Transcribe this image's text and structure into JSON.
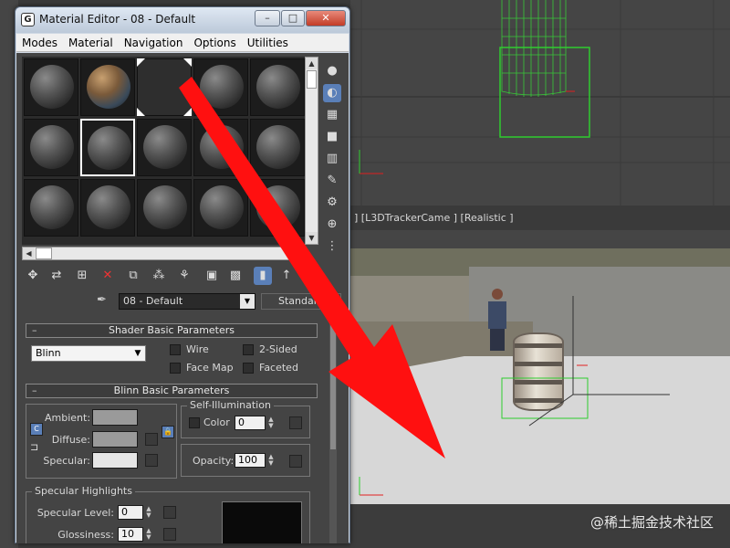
{
  "window": {
    "title": "Material Editor - 08 - Default",
    "app_icon": "G",
    "controls": [
      "–",
      "□",
      "✕"
    ]
  },
  "menu": [
    "Modes",
    "Material",
    "Navigation",
    "Options",
    "Utilities"
  ],
  "viewport_label": "] [L3DTrackerCame ] [Realistic ]",
  "material": {
    "name": "08 - Default",
    "type": "Standard"
  },
  "shader_basic": {
    "title": "Shader Basic Parameters",
    "shader": "Blinn",
    "wire": "Wire",
    "two_sided": "2-Sided",
    "face_map": "Face Map",
    "faceted": "Faceted"
  },
  "blinn_basic": {
    "title": "Blinn Basic Parameters",
    "self_illum_title": "Self-Illumination",
    "color_label": "Color",
    "color_value": "0",
    "ambient": "Ambient:",
    "diffuse": "Diffuse:",
    "specular": "Specular:",
    "opacity_label": "Opacity:",
    "opacity_value": "100",
    "ambient_color": "#9a9a9a",
    "diffuse_color": "#9a9a9a",
    "specular_color": "#e6e6e6"
  },
  "specular_highlights": {
    "title": "Specular Highlights",
    "level_label": "Specular Level:",
    "level_value": "0",
    "gloss_label": "Glossiness:",
    "gloss_value": "10"
  },
  "minimize_sign": "–",
  "watermark": "@稀土掘金技术社区",
  "colors": {
    "arrow": "#ff1010",
    "selection_green": "#2ecc2e"
  }
}
